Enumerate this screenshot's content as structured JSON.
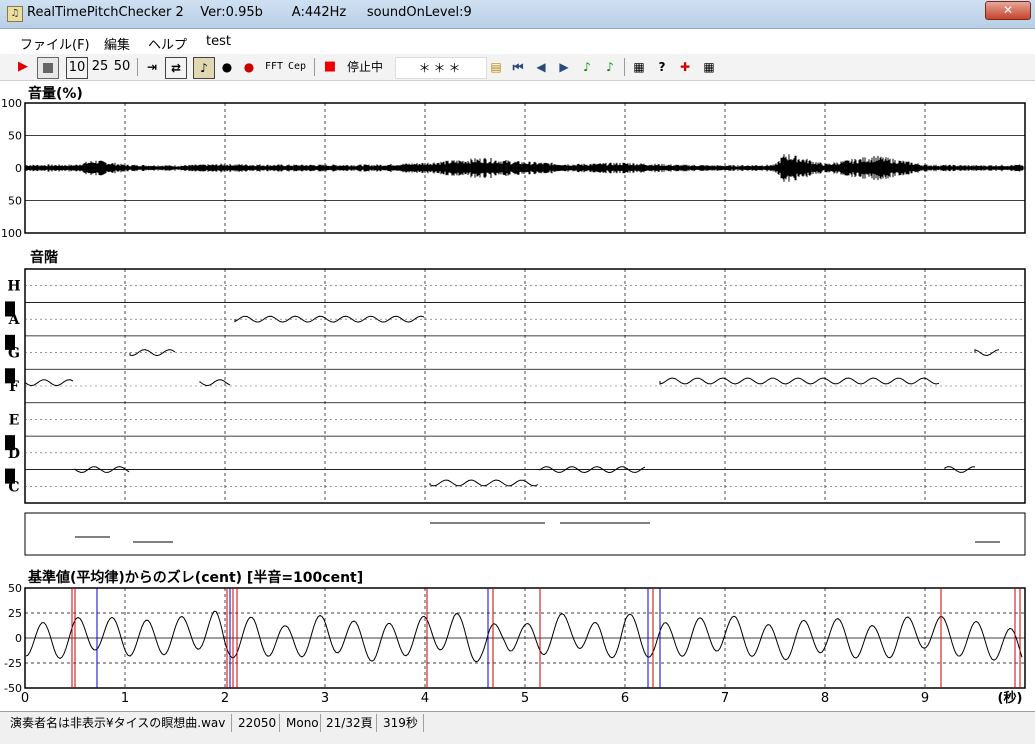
{
  "window": {
    "title": "RealTimePitchChecker 2    Ver:0.95b       A:442Hz     soundOnLevel:9",
    "close_label": "✕"
  },
  "menu": [
    "ファイル(F)",
    "編集",
    "ヘルプ",
    "test"
  ],
  "toolbar": {
    "tempo_options": [
      "10",
      "25",
      "50"
    ],
    "fft_label": "FFT",
    "cep_label": "Cep",
    "status": "停止中",
    "stars": "＊＊＊",
    "icons": [
      "play-icon",
      "stop-icon",
      "jump-end-icon",
      "loop-icon",
      "violin-icon",
      "person-icon",
      "person-red-icon",
      "folder-open-icon",
      "skip-first-icon",
      "prev-icon",
      "next-icon",
      "note-green-icon",
      "note-green2-icon",
      "print-icon",
      "help-icon",
      "marker-icon",
      "printer-icon"
    ]
  },
  "sections": {
    "volume_title": "音量(%)",
    "scale_title": "音階",
    "deviation_title": "基準値(平均律)からのズレ(cent) [半音=100cent]"
  },
  "volume_ticks": [
    "100",
    "50",
    "0",
    "50",
    "100"
  ],
  "note_labels": [
    "H",
    "A",
    "G",
    "F",
    "E",
    "D",
    "C"
  ],
  "deviation_ticks": [
    "50",
    "25",
    "0",
    "-25",
    "-50"
  ],
  "time_axis": {
    "ticks": [
      "0",
      "1",
      "2",
      "3",
      "4",
      "5",
      "6",
      "7",
      "8",
      "9"
    ],
    "unit": "(秒)"
  },
  "status": {
    "file": "演奏者名は非表示¥タイスの瞑想曲.wav",
    "rate": "22050",
    "channels": "Mono",
    "page": "21/32頁",
    "duration": "319秒"
  },
  "chart_data": {
    "type": "line",
    "volume_envelope": {
      "x": [
        0,
        0.5,
        0.7,
        1.0,
        1.5,
        2.0,
        2.5,
        3.0,
        3.5,
        4.0,
        4.6,
        4.9,
        5.5,
        6.0,
        6.5,
        7.0,
        7.5,
        7.6,
        8.0,
        8.5,
        9.0,
        9.5,
        10.0
      ],
      "y": [
        5,
        5,
        12,
        5,
        4,
        6,
        5,
        5,
        5,
        8,
        15,
        10,
        6,
        8,
        5,
        4,
        5,
        22,
        6,
        18,
        5,
        4,
        5
      ]
    },
    "pitch_segments": [
      {
        "x": [
          0.0,
          0.5
        ],
        "note": 3.6
      },
      {
        "x": [
          0.5,
          1.05
        ],
        "note": 1.0
      },
      {
        "x": [
          1.05,
          1.5
        ],
        "note": 4.5
      },
      {
        "x": [
          1.75,
          2.05
        ],
        "note": 3.6
      },
      {
        "x": [
          2.1,
          4.0
        ],
        "note": 5.5
      },
      {
        "x": [
          4.05,
          5.15
        ],
        "note": 0.6
      },
      {
        "x": [
          5.15,
          6.2
        ],
        "note": 1.0
      },
      {
        "x": [
          6.35,
          9.15
        ],
        "note": 3.65
      },
      {
        "x": [
          9.2,
          9.5
        ],
        "note": 1.0
      },
      {
        "x": [
          9.5,
          9.75
        ],
        "note": 4.5
      }
    ],
    "deviation": {
      "x": [
        0,
        0.3,
        0.5,
        0.7,
        1.0,
        1.3,
        1.6,
        1.9,
        2.0,
        2.3,
        2.6,
        3.0,
        3.5,
        4.0,
        4.3,
        4.6,
        4.8,
        5.0,
        5.5,
        5.8,
        6.0,
        6.3,
        6.6,
        7.0,
        7.5,
        8.0,
        8.5,
        9.0,
        9.3,
        9.6,
        10.0
      ],
      "y": [
        0,
        -10,
        5,
        15,
        0,
        0,
        10,
        25,
        -10,
        10,
        -15,
        15,
        -15,
        10,
        20,
        -30,
        20,
        -10,
        25,
        -20,
        20,
        -10,
        0,
        15,
        -15,
        10,
        -15,
        20,
        0,
        -5,
        -30
      ]
    },
    "xlim": [
      0,
      10
    ],
    "xlabel": "(秒)"
  }
}
